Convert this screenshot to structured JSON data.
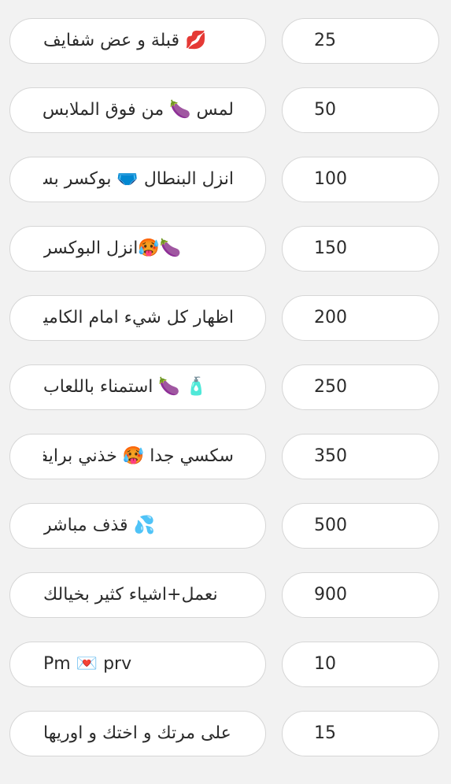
{
  "rows": [
    {
      "text": "💋 قبلة و عض شفايف",
      "value": "25",
      "dir": "rtl"
    },
    {
      "text": "لمس 🍆 من فوق الملابس",
      "value": "50",
      "dir": "rtl"
    },
    {
      "text": "انزل البنطال 🩲 بوكسر بس",
      "value": "100",
      "dir": "rtl"
    },
    {
      "text": "🍆🥵انزل البوكسر",
      "value": "150",
      "dir": "rtl"
    },
    {
      "text": "اظهار كل شيء امام الكاميرا",
      "value": "200",
      "dir": "rtl"
    },
    {
      "text": "🧴 🍆 استمناء باللعاب",
      "value": "250",
      "dir": "rtl"
    },
    {
      "text": "سكسي جدا 🥵 خذني برايفت",
      "value": "350",
      "dir": "rtl"
    },
    {
      "text": "💦 قذف مباشر",
      "value": "500",
      "dir": "rtl"
    },
    {
      "text": "نعمل+اشياء كثير بخيالك",
      "value": "900",
      "dir": "rtl"
    },
    {
      "text": "Pm 💌 prv",
      "value": "10",
      "dir": "ltr"
    },
    {
      "text": "على مرتك و اختك و اوريها",
      "value": "15",
      "dir": "rtl"
    }
  ]
}
